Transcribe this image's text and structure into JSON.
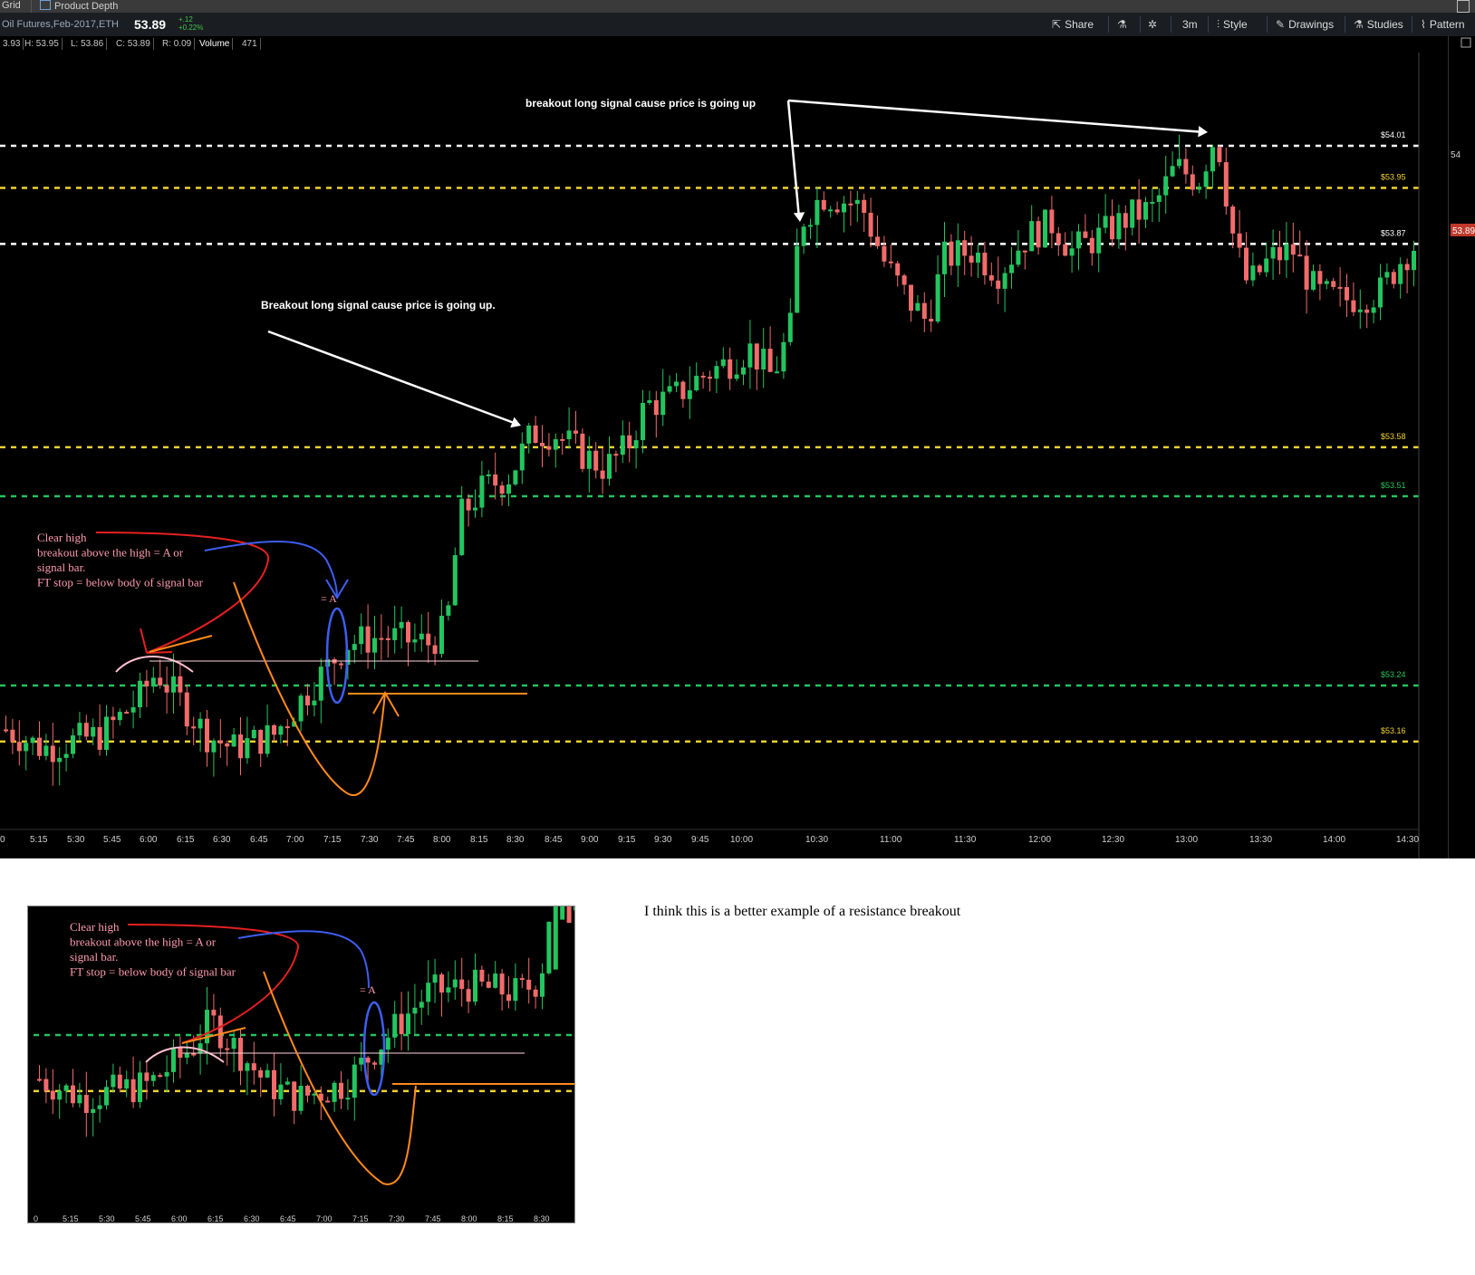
{
  "window": {
    "tabs": [
      "Grid",
      "Product Depth"
    ],
    "symbol": "Oil Futures,Feb-2017,ETH",
    "price": "53.89",
    "change": "+.12",
    "change_pct": "+0.22%"
  },
  "toolbar": {
    "share": "Share",
    "interval": "3m",
    "style": "Style",
    "drawings": "Drawings",
    "studies": "Studies",
    "patterns": "Pattern"
  },
  "ohlc": {
    "open": "3.93",
    "high": "H: 53.95",
    "low": "L: 53.86",
    "close": "C: 53.89",
    "range": "R: 0.09",
    "volume_label": "Volume",
    "volume": "471"
  },
  "colors": {
    "up": "#22c55e",
    "down": "#f26b6b",
    "white_level": "#ffffff",
    "yellow_level": "#f2d22e",
    "green_level": "#22c55e"
  },
  "chart_data": {
    "type": "candlestick",
    "x_ticks": [
      "0",
      "5:15",
      "5:30",
      "5:45",
      "6:00",
      "6:15",
      "6:30",
      "6:45",
      "7:00",
      "7:15",
      "7:30",
      "7:45",
      "8:00",
      "8:15",
      "8:30",
      "8:45",
      "9:00",
      "9:15",
      "9:30",
      "9:45",
      "10:00",
      "10:30",
      "11:00",
      "11:30",
      "12:00",
      "12:30",
      "13:00",
      "13:30",
      "14:00",
      "14:30"
    ],
    "y_tick": "54",
    "last_price_tag": "53.89",
    "levels": [
      {
        "label": "$54.01",
        "value": 54.01,
        "color": "white"
      },
      {
        "label": "$53.95",
        "value": 53.95,
        "color": "yellow"
      },
      {
        "label": "$53.87",
        "value": 53.87,
        "color": "white"
      },
      {
        "label": "$53.58",
        "value": 53.58,
        "color": "yellow"
      },
      {
        "label": "$53.51",
        "value": 53.51,
        "color": "green"
      },
      {
        "label": "$53.24",
        "value": 53.24,
        "color": "green"
      },
      {
        "label": "$53.16",
        "value": 53.16,
        "color": "yellow"
      }
    ],
    "annotations": [
      "breakout long signal cause price is going up",
      "Breakout long signal cause price is going up.",
      "Clear high",
      "breakout above the high = A or",
      "signal bar.",
      "FT stop = below body of signal bar",
      "= A"
    ]
  },
  "inset": {
    "x_ticks": [
      "0",
      "5:15",
      "5:30",
      "5:45",
      "6:00",
      "6:15",
      "6:30",
      "6:45",
      "7:00",
      "7:15",
      "7:30",
      "7:45",
      "8:00",
      "8:15",
      "8:30"
    ],
    "annotations": [
      "Clear high",
      "breakout above the high = A or",
      "signal bar.",
      "FT stop = below body of signal bar",
      "= A"
    ]
  },
  "comment": "I think this is a better example of a resistance breakout"
}
